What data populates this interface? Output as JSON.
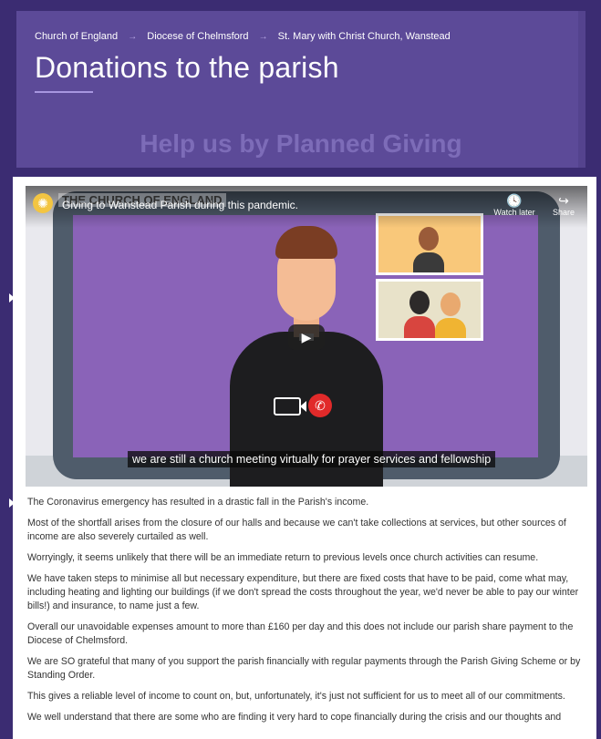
{
  "header": {
    "breadcrumb": [
      "Church of England",
      "Diocese of Chelmsford",
      "St. Mary with Christ Church, Wanstead"
    ],
    "breadcrumb_separator": "→",
    "title": "Donations to the parish",
    "subheading": "Help us by Planned Giving"
  },
  "video": {
    "channel_name": "THE CHURCH OF ENGLAND",
    "title": "Giving to Wanstead Parish during this pandemic.",
    "actions": [
      {
        "label": "Watch later",
        "icon": "clock-icon",
        "glyph": "🕓"
      },
      {
        "label": "Share",
        "icon": "share-icon",
        "glyph": "↪"
      }
    ],
    "play_glyph": "▶",
    "hangup_glyph": "✆",
    "logo_glyph": "✺",
    "caption": "we are still a church meeting virtually for prayer services and fellowship"
  },
  "article": {
    "paragraphs": [
      "The Coronavirus emergency has resulted in a drastic fall in the Parish's income.",
      "Most of the shortfall arises from the closure of our halls and because we can't take collections at services, but other sources of income are also severely curtailed as well.",
      "Worryingly, it seems unlikely that there will be an immediate return to previous levels once church activities can resume.",
      "We have taken steps to minimise all but necessary expenditure, but there are fixed costs that have to be paid, come what may, including heating and lighting our buildings (if we don't spread the costs throughout the year, we'd never be able to pay our winter bills!) and insurance, to name just a few.",
      "Overall our unavoidable expenses amount to more than £160 per day and this does not include our parish share payment to the Diocese of Chelmsford.",
      "We are SO grateful that many of you support the parish financially with regular payments through the Parish Giving Scheme or by Standing Order.",
      "This gives a reliable level of income to count on, but, unfortunately, it's just not sufficient for us to meet all of our commitments.",
      "We well understand that there are some who are finding it very hard to cope financially during the crisis and our thoughts and"
    ]
  },
  "colors": {
    "frame": "#3b2c72",
    "hero": "#5c4a98",
    "subheading": "#7d6cb8",
    "text": "#333333"
  }
}
